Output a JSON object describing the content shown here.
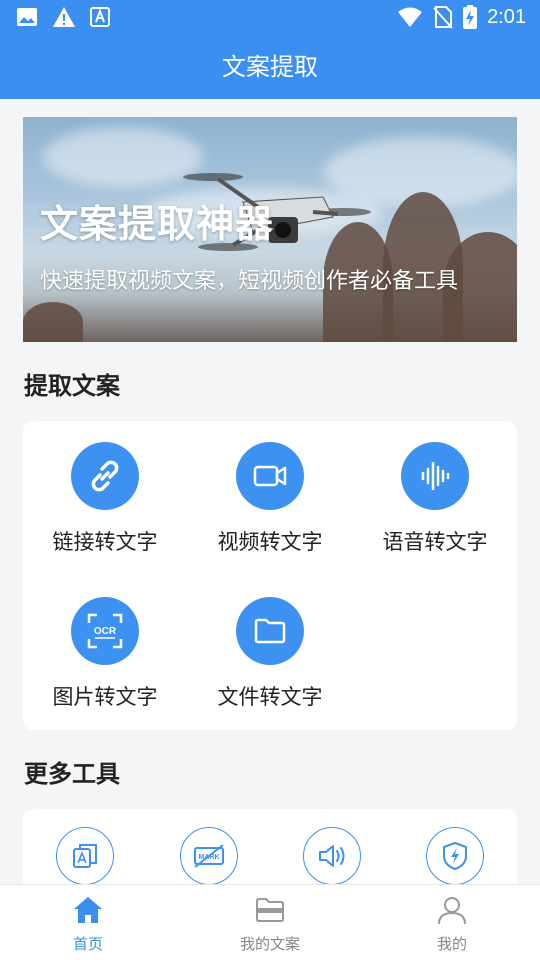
{
  "status_bar": {
    "time": "2:01"
  },
  "header": {
    "title": "文案提取"
  },
  "banner": {
    "title": "文案提取神器",
    "subtitle": "快速提取视频文案，短视频创作者必备工具"
  },
  "extract_section": {
    "title": "提取文案",
    "tools": [
      {
        "label": "链接转文字",
        "icon": "link-icon"
      },
      {
        "label": "视频转文字",
        "icon": "video-camera-icon"
      },
      {
        "label": "语音转文字",
        "icon": "audio-wave-icon"
      },
      {
        "label": "图片转文字",
        "icon": "ocr-scan-icon"
      },
      {
        "label": "文件转文字",
        "icon": "folder-icon"
      }
    ]
  },
  "more_section": {
    "title": "更多工具",
    "tools": [
      {
        "icon": "text-copy-icon"
      },
      {
        "icon": "watermark-remove-icon"
      },
      {
        "icon": "speaker-icon"
      },
      {
        "icon": "shield-bolt-icon"
      }
    ]
  },
  "bottom_nav": {
    "items": [
      {
        "label": "首页",
        "icon": "home-icon",
        "active": true
      },
      {
        "label": "我的文案",
        "icon": "folder-card-icon",
        "active": false
      },
      {
        "label": "我的",
        "icon": "user-icon",
        "active": false
      }
    ]
  },
  "colors": {
    "primary": "#3a8ff0",
    "icon_blue": "#3d92f1",
    "background": "#f4f5f7"
  }
}
